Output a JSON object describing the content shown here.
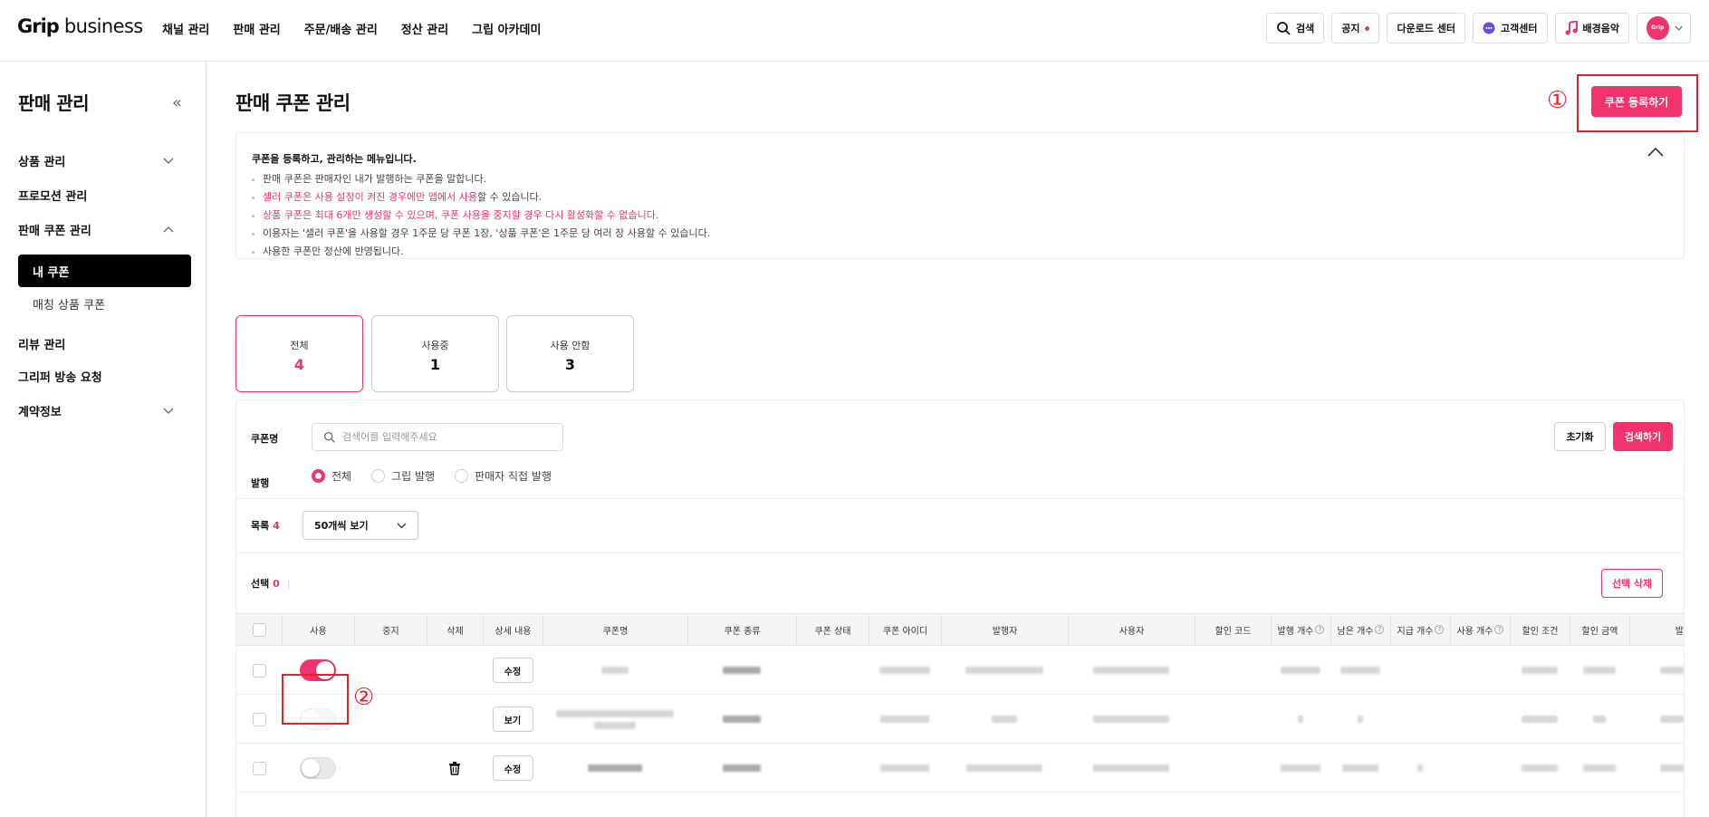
{
  "brand": {
    "bold": "Grip",
    "light": " business"
  },
  "gnb": [
    "채널 관리",
    "판매 관리",
    "주문/배송 관리",
    "정산 관리",
    "그립 아카데미"
  ],
  "top_actions": {
    "search": "검색",
    "notice": "공지",
    "download": "다운로드 센터",
    "support": "고객센터",
    "music": "배경음악",
    "avatar_text": "Grip"
  },
  "sidebar": {
    "title": "판매 관리",
    "items": [
      {
        "label": "상품 관리"
      },
      {
        "label": "프로모션 관리"
      },
      {
        "label": "판매 쿠폰 관리"
      },
      {
        "label": "리뷰 관리"
      },
      {
        "label": "그리퍼 방송 요청"
      },
      {
        "label": "계약정보"
      }
    ],
    "sub_active": "내 쿠폰",
    "sub_item": "매칭 상품 쿠폰"
  },
  "page": {
    "title": "판매 쿠폰 관리",
    "register_button": "쿠폰 등록하기",
    "annotation_1": "①",
    "annotation_2": "②"
  },
  "info": {
    "heading": "쿠폰을 등록하고, 관리하는 메뉴입니다.",
    "line1": "판매 쿠폰은 판매자인 내가 발행하는 쿠폰을 말합니다.",
    "line2_a": "셀러 쿠폰은 사용 설정이 켜진 경우에만 앱에서 사용",
    "line2_b": "할 수 있습니다.",
    "line3_a": "상품 쿠폰은 최대 6개만 생성할 수 있으며, ",
    "line3_b": "쿠폰 사용을 중지할 경우 다시 활성화할 수 없습니다.",
    "line4": "이용자는 '셀러 쿠폰'을 사용할 경우 1주문 당 쿠폰 1장, '상품 쿠폰'은 1주문 당 여러 장 사용할 수 있습니다.",
    "line5": "사용한 쿠폰만 정산에 반영됩니다."
  },
  "stats": [
    {
      "label": "전체",
      "value": "4"
    },
    {
      "label": "사용중",
      "value": "1"
    },
    {
      "label": "사용 안함",
      "value": "3"
    }
  ],
  "filters": {
    "coupon_name_label": "쿠폰명",
    "search_placeholder": "검색어를 입력해주세요",
    "reset": "초기화",
    "search_button": "검색하기",
    "issue_label": "발행",
    "issue_options": [
      "전체",
      "그립 발행",
      "판매자 직접 발행"
    ],
    "issue_selected": "전체"
  },
  "list": {
    "label": "목록",
    "count": "4",
    "per_page": "50개씩 보기",
    "selected_label": "선택",
    "selected_count": "0",
    "delete_selected": "선택 삭제"
  },
  "table": {
    "columns": [
      "사용",
      "중지",
      "삭제",
      "상세 내용",
      "쿠폰명",
      "쿠폰 종류",
      "쿠폰 상태",
      "쿠폰 아이디",
      "발행자",
      "사용자",
      "할인 코드",
      "발행 개수",
      "남은 개수",
      "지급 개수",
      "사용 개수",
      "할인 조건",
      "할인 금액",
      "발"
    ],
    "help_mark": "?",
    "rows": [
      {
        "toggle": "on",
        "action": "수정"
      },
      {
        "toggle": "disabled",
        "action": "보기"
      },
      {
        "toggle": "off",
        "action": "수정"
      }
    ]
  },
  "colors": {
    "accent": "#f0336f",
    "annotation": "#e0242a"
  }
}
